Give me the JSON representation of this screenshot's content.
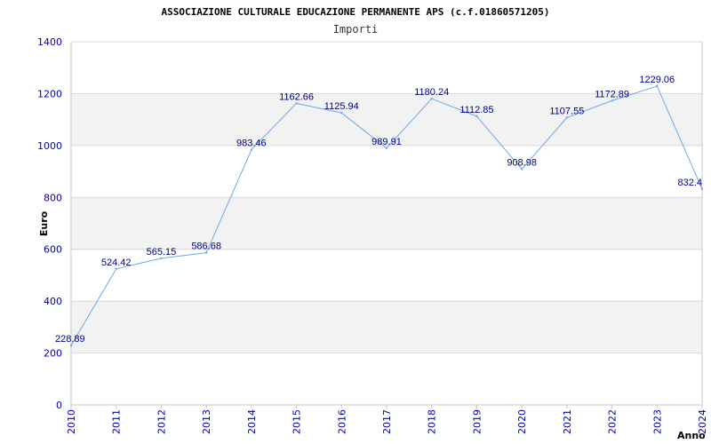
{
  "chart_data": {
    "type": "line",
    "title": "ASSOCIAZIONE CULTURALE EDUCAZIONE PERMANENTE APS (c.f.01860571205)",
    "subtitle": "Importi",
    "xlabel": "Anno",
    "ylabel": "Euro",
    "ylim": [
      0,
      1400
    ],
    "yticks": [
      "0",
      "200",
      "400",
      "600",
      "800",
      "1000",
      "1200",
      "1400"
    ],
    "grid": true,
    "x": [
      "2010",
      "2011",
      "2012",
      "2013",
      "2014",
      "2015",
      "2016",
      "2017",
      "2018",
      "2019",
      "2020",
      "2021",
      "2022",
      "2023",
      "2024"
    ],
    "series": [
      {
        "values": [
          228.89,
          524.42,
          565.15,
          586.68,
          983.46,
          1162.66,
          1125.94,
          989.91,
          1180.24,
          1112.85,
          908.98,
          1107.55,
          1172.89,
          1229.06,
          832.4
        ],
        "labels": [
          "228.89",
          "524.42",
          "565.15",
          "586.68",
          "983.46",
          "1162.66",
          "1125.94",
          "989.91",
          "1180.24",
          "1112.85",
          "908.98",
          "1107.55",
          "1172.89",
          "1229.06",
          "832.4"
        ]
      }
    ],
    "colors": {
      "line": "#6fa8e8",
      "band": "#f2f2f2",
      "grid": "#d8d8d8",
      "tick_text": "#0000aa",
      "label_text": "#000080"
    }
  }
}
